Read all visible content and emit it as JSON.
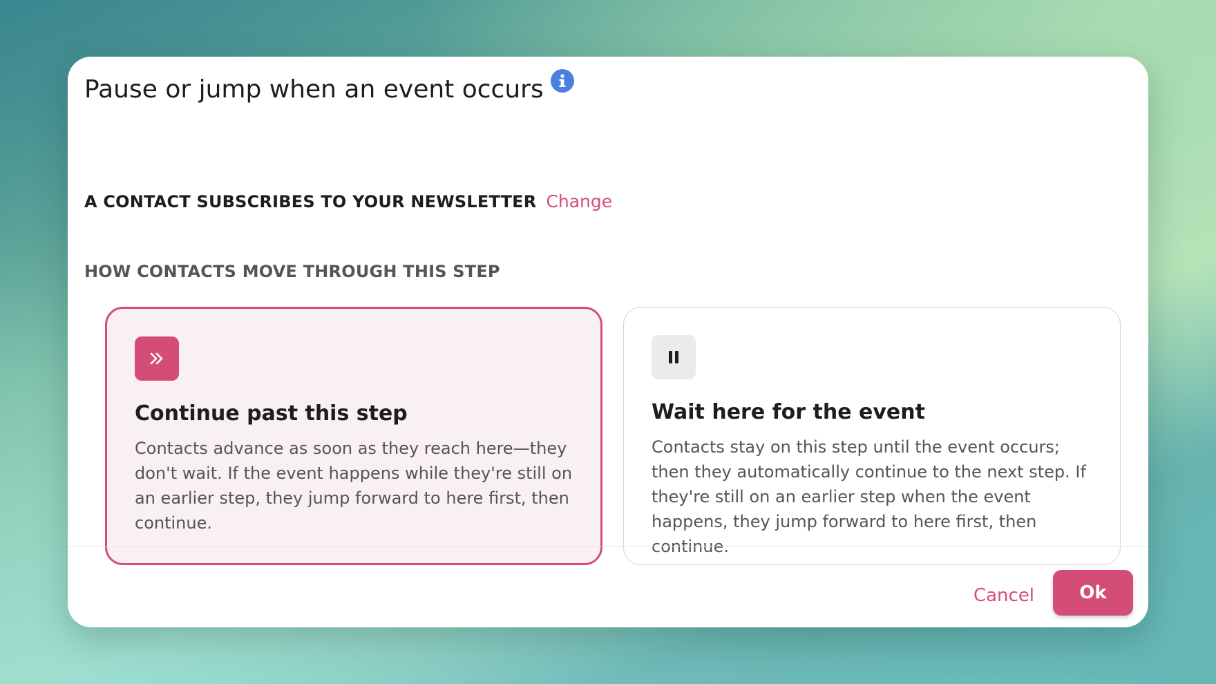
{
  "dialog": {
    "title": "Pause or jump when an event occurs",
    "info_icon": "info-icon",
    "event_name": "A CONTACT SUBSCRIBES TO YOUR NEWSLETTER",
    "change_label": "Change",
    "section_label": "HOW CONTACTS MOVE THROUGH THIS STEP",
    "options": [
      {
        "icon": "double-chevron-right-icon",
        "title": "Continue past this step",
        "description": "Contacts advance as soon as they reach here—they don't wait. If the event happens while they're still on an earlier step, they jump forward to here first, then continue.",
        "selected": true
      },
      {
        "icon": "pause-icon",
        "title": "Wait here for the event",
        "description": "Contacts stay on this step until the event occurs; then they automatically continue to the next step. If they're still on an earlier step when the event happens, they jump forward to here first, then continue.",
        "selected": false
      }
    ],
    "cancel_label": "Cancel",
    "ok_label": "Ok"
  },
  "colors": {
    "accent": "#d44d77",
    "selected_bg": "#f9f0f3",
    "info_blue": "#4a7fe0",
    "text_dark": "#1d1d1d",
    "text_muted": "#555555"
  }
}
